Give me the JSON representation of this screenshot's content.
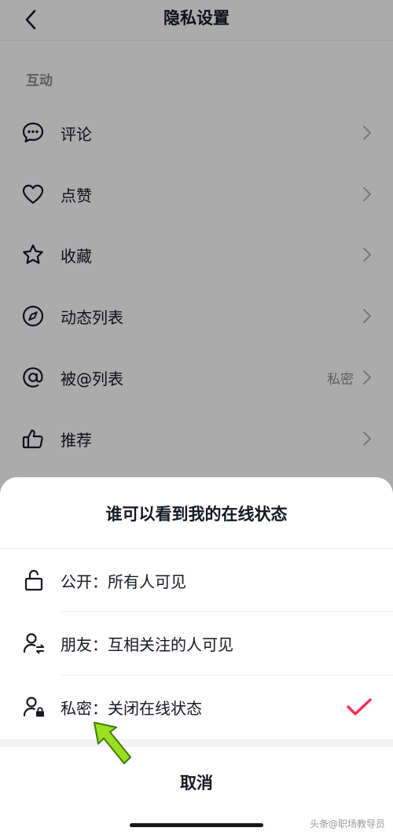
{
  "header": {
    "title": "隐私设置"
  },
  "section": {
    "title": "互动"
  },
  "rows": [
    {
      "label": "评论",
      "icon": "comment-icon",
      "value": ""
    },
    {
      "label": "点赞",
      "icon": "heart-icon",
      "value": ""
    },
    {
      "label": "收藏",
      "icon": "star-icon",
      "value": ""
    },
    {
      "label": "动态列表",
      "icon": "compass-icon",
      "value": ""
    },
    {
      "label": "被@列表",
      "icon": "at-icon",
      "value": "私密"
    },
    {
      "label": "推荐",
      "icon": "thumbs-up-icon",
      "value": ""
    }
  ],
  "sheet": {
    "title": "谁可以看到我的在线状态",
    "options": [
      {
        "label": "公开：所有人可见",
        "icon": "unlock-icon",
        "selected": false
      },
      {
        "label": "朋友：互相关注的人可见",
        "icon": "friends-icon",
        "selected": false
      },
      {
        "label": "私密：关闭在线状态",
        "icon": "person-lock-icon",
        "selected": true
      }
    ],
    "cancel": "取消"
  },
  "colors": {
    "accent": "#FE2C55",
    "arrow": "#9BE020",
    "overlay": "rgba(0,0,0,0.33)"
  },
  "watermark": "头条@职场教导员"
}
